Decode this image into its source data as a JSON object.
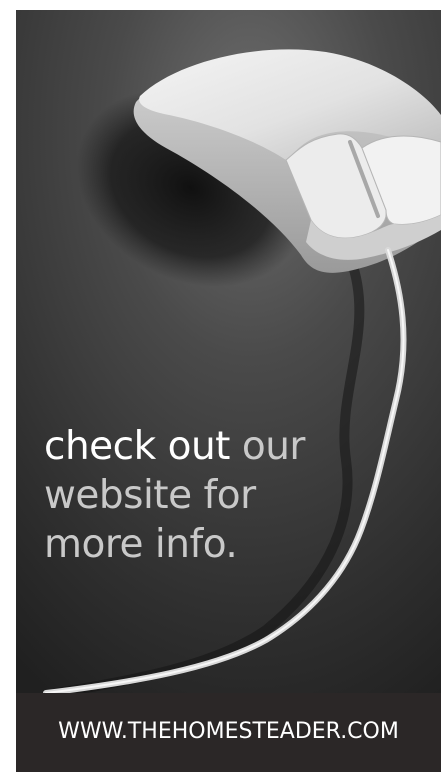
{
  "ad": {
    "headline": {
      "line1_emphasis": "check out",
      "line1_rest": " our",
      "line2": "website for",
      "line3": "more info."
    },
    "footer": {
      "url": "WWW.THEHOMESTEADER.COM"
    },
    "image": {
      "subject": "computer-mouse",
      "style": "black-and-white photograph"
    },
    "colors": {
      "background_dark": "#2a2a2a",
      "footer_bar": "#2b2727",
      "headline_light": "#c9c9c9",
      "headline_emphasis": "#ffffff",
      "url_text": "#ffffff"
    }
  }
}
